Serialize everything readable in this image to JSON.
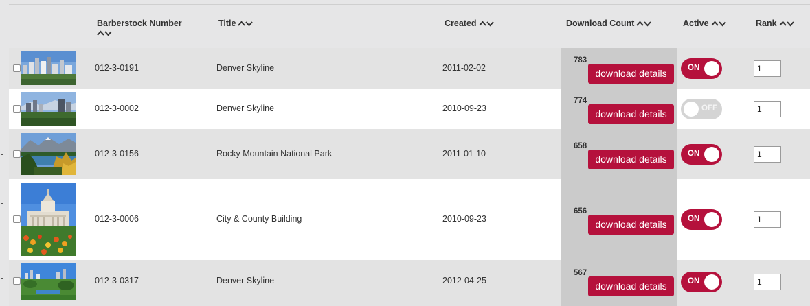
{
  "headers": {
    "barberstock_number": "Barberstock Number",
    "title": "Title",
    "created": "Created",
    "download_count": "Download Count",
    "active": "Active",
    "rank": "Rank"
  },
  "download_button_label": "download details",
  "toggle_labels": {
    "on": "ON",
    "off": "OFF"
  },
  "colors": {
    "accent": "#b5113c",
    "toggle_off": "#d4d4d4",
    "row_gray": "#e3e3e3",
    "download_column": "#cbcbcb"
  },
  "rows": [
    {
      "image": "skyline-thumbnail",
      "number": "012-3-0191",
      "title": "Denver Skyline",
      "created": "2011-02-02",
      "download_count": "783",
      "active": true,
      "rank": "1"
    },
    {
      "image": "skyline-thumbnail",
      "number": "012-3-0002",
      "title": "Denver Skyline",
      "created": "2010-09-23",
      "download_count": "774",
      "active": false,
      "rank": "1"
    },
    {
      "image": "mountain-lake-thumbnail",
      "number": "012-3-0156",
      "title": "Rocky Mountain National Park",
      "created": "2011-01-10",
      "download_count": "658",
      "active": true,
      "rank": "1"
    },
    {
      "image": "capitol-building-thumbnail",
      "number": "012-3-0006",
      "title": "City & County Building",
      "created": "2010-09-23",
      "download_count": "656",
      "active": true,
      "rank": "1"
    },
    {
      "image": "skyline-park-thumbnail",
      "number": "012-3-0317",
      "title": "Denver Skyline",
      "created": "2012-04-25",
      "download_count": "567",
      "active": true,
      "rank": "1"
    }
  ]
}
